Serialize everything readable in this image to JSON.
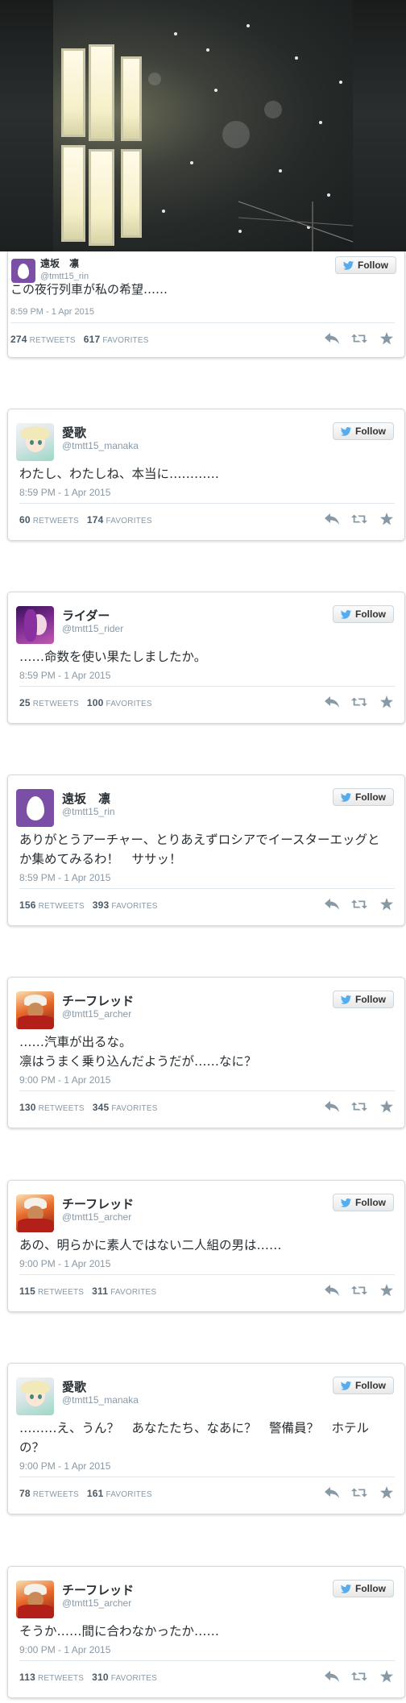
{
  "colors": {
    "egg_avatar": "#7c4fa7",
    "muted": "#8899a6",
    "twitter_blue": "#55acee"
  },
  "follow_label": "Follow",
  "tweets": [
    {
      "name": "遠坂　凛",
      "handle": "@tmtt15_rin",
      "avatar": "egg-avatar",
      "text": "この夜行列車が私の希望……",
      "time": "8:59 PM - 1 Apr 2015",
      "retweets": "274",
      "favorites": "617"
    },
    {
      "name": "愛歌",
      "handle": "@tmtt15_manaka",
      "avatar": "anime-girl-avatar",
      "text": "わたし、わたしね、本当に…………",
      "time": "8:59 PM - 1 Apr 2015",
      "retweets": "60",
      "favorites": "174"
    },
    {
      "name": "ライダー",
      "handle": "@tmtt15_rider",
      "avatar": "purple-hair-avatar",
      "text": "……命数を使い果たしましたか。",
      "time": "8:59 PM - 1 Apr 2015",
      "retweets": "25",
      "favorites": "100"
    },
    {
      "name": "遠坂　凛",
      "handle": "@tmtt15_rin",
      "avatar": "egg-avatar",
      "text": "ありがとうアーチャー、とりあえずロシアでイースターエッグとか集めてみるわ！　ササッ！",
      "time": "8:59 PM - 1 Apr 2015",
      "retweets": "156",
      "favorites": "393"
    },
    {
      "name": "チーフレッド",
      "handle": "@tmtt15_archer",
      "avatar": "red-hero-avatar",
      "text_lines": [
        "……汽車が出るな。",
        "凛はうまく乗り込んだようだが……なに？"
      ],
      "time": "9:00 PM - 1 Apr 2015",
      "retweets": "130",
      "favorites": "345"
    },
    {
      "name": "チーフレッド",
      "handle": "@tmtt15_archer",
      "avatar": "red-hero-avatar",
      "text": "あの、明らかに素人ではない二人組の男は……",
      "time": "9:00 PM - 1 Apr 2015",
      "retweets": "115",
      "favorites": "311"
    },
    {
      "name": "愛歌",
      "handle": "@tmtt15_manaka",
      "avatar": "anime-girl-avatar",
      "text": "………え、うん？　あなたたち、なあに？　警備員？　ホテルの？",
      "time": "9:00 PM - 1 Apr 2015",
      "retweets": "78",
      "favorites": "161"
    },
    {
      "name": "チーフレッド",
      "handle": "@tmtt15_archer",
      "avatar": "red-hero-avatar",
      "text": "そうか……間に合わなかったか……",
      "time": "9:00 PM - 1 Apr 2015",
      "retweets": "113",
      "favorites": "310"
    }
  ],
  "labels": {
    "retweets": "RETWEETS",
    "favorites": "FAVORITES"
  }
}
